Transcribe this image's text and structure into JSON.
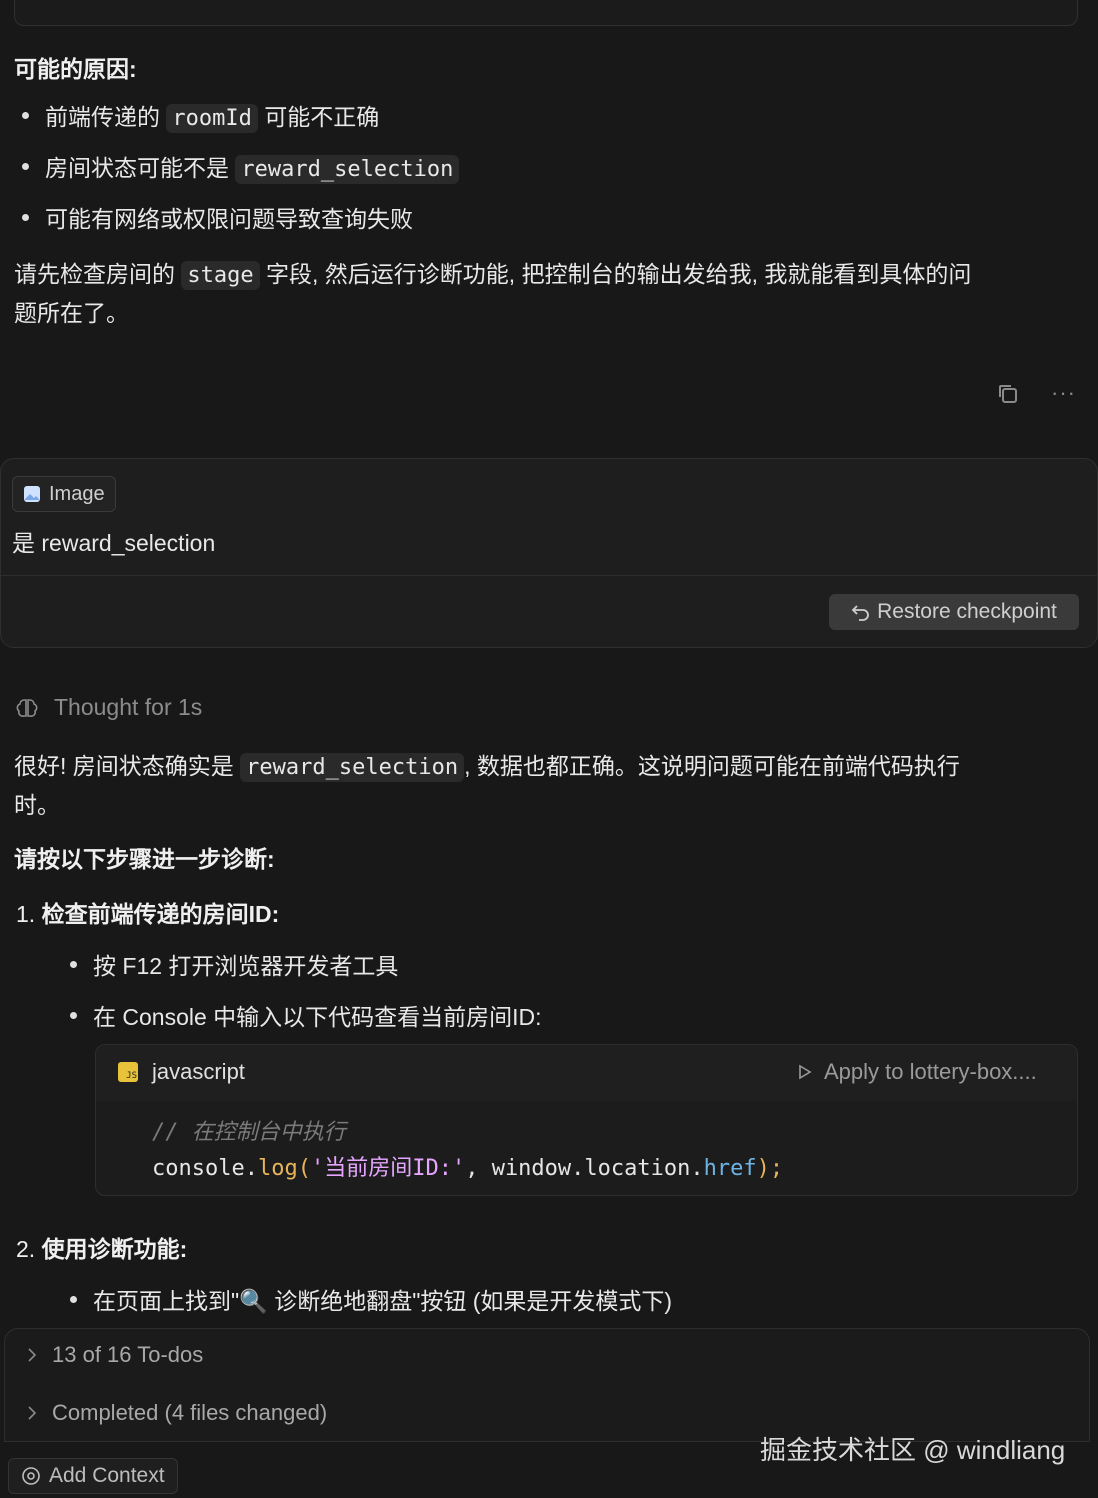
{
  "causes": {
    "heading": "可能的原因:",
    "items": [
      {
        "before": "前端传递的",
        "code": "roomId",
        "after": "可能不正确"
      },
      {
        "before": "房间状态可能不是",
        "code": "reward_selection",
        "after": ""
      },
      {
        "before": "可能有网络或权限问题导致查询失败",
        "code": "",
        "after": ""
      }
    ]
  },
  "advice": {
    "before": "请先检查房间的",
    "code": "stage",
    "after_line1": "字段, 然后运行诊断功能, 把控制台的输出发给我, 我就能看到具体的问",
    "line2": "题所在了。"
  },
  "actions": {
    "copy_icon": "copy-icon",
    "more_icon": "ellipsis-icon",
    "more_label": "···"
  },
  "user_message": {
    "chip_label": "Image",
    "text": "是 reward_selection",
    "restore_label": "Restore checkpoint"
  },
  "thought": {
    "label": "Thought for 1s"
  },
  "reply": {
    "line1_before": "很好! 房间状态确实是",
    "line1_code": "reward_selection",
    "line1_after": ", 数据也都正确。这说明问题可能在前端代码执行",
    "line2": "时。",
    "steps_heading": "请按以下步骤进一步诊断:",
    "step1": {
      "num": "1.",
      "title": "检查前端传递的房间ID:"
    },
    "step1_bullets": [
      "按 F12 打开浏览器开发者工具",
      "在 Console 中输入以下代码查看当前房间ID:"
    ],
    "code_block": {
      "lang": "javascript",
      "lang_badge": "JS",
      "apply_label": "Apply to lottery-box....",
      "comment": "//  在控制台中执行",
      "code_obj": "console",
      "code_dot": ".",
      "code_fn": "log",
      "code_open": "(",
      "code_str": "'当前房间ID:'",
      "code_mid": ", window.location.",
      "code_prop": "href",
      "code_close": ");"
    },
    "step2": {
      "num": "2.",
      "title": "使用诊断功能:"
    },
    "step2_bullet": "在页面上找到\"🔍 诊断绝地翻盘\"按钮 (如果是开发模式下)"
  },
  "todos": {
    "label": "13 of 16 To-dos",
    "completed": "Completed (4 files changed)"
  },
  "footer": {
    "add_context": "Add Context",
    "watermark": "掘金技术社区 @ windliang"
  },
  "colors": {
    "background": "#181818",
    "code_string": "#e8b45a",
    "code_keyword": "#6db4e6",
    "code_comment": "#7a7a7a"
  }
}
